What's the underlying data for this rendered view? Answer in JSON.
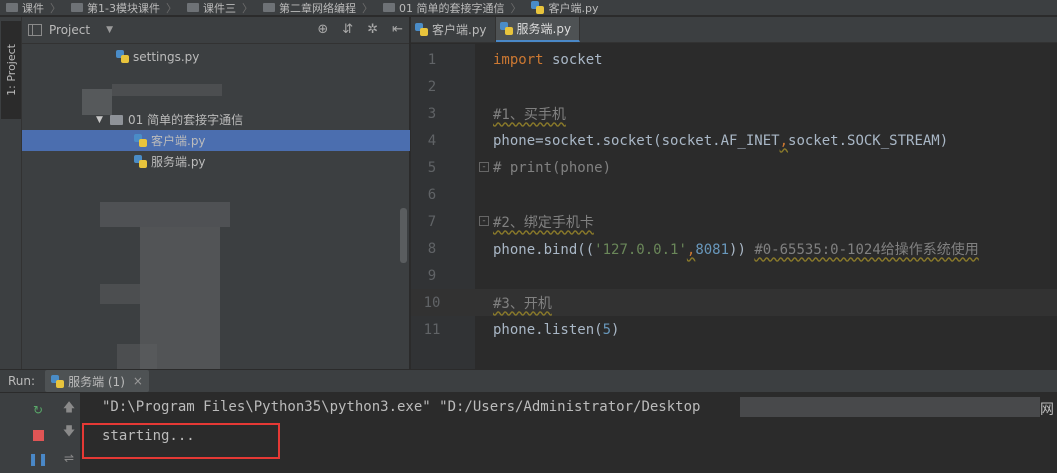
{
  "breadcrumb": [
    {
      "label": "课件",
      "icon": "folder-icon"
    },
    {
      "label": "第1-3模块课件",
      "icon": "folder-icon"
    },
    {
      "label": "课件三",
      "icon": "folder-icon"
    },
    {
      "label": "第二章网络编程",
      "icon": "folder-icon"
    },
    {
      "label": "01 简单的套接字通信",
      "icon": "folder-icon"
    },
    {
      "label": "客户端.py",
      "icon": "python-file-icon"
    }
  ],
  "tool_stripe": {
    "project_tab": "1: Project"
  },
  "project_panel": {
    "title": "Project",
    "tools": [
      "⊕",
      "⇵",
      "✲",
      "⇤"
    ],
    "tree": [
      {
        "label": "settings.py",
        "type": "file"
      },
      {
        "label": "01 简单的套接字通信",
        "type": "folder"
      },
      {
        "label": "客户端.py",
        "type": "file",
        "selected": true
      },
      {
        "label": "服务端.py",
        "type": "file"
      }
    ]
  },
  "editor": {
    "tabs": [
      {
        "label": "客户端.py",
        "active": false
      },
      {
        "label": "服务端.py",
        "active": true
      }
    ],
    "line_numbers": [
      "1",
      "2",
      "3",
      "4",
      "5",
      "6",
      "7",
      "8",
      "9",
      "10",
      "11"
    ]
  },
  "run_panel": {
    "label": "Run:",
    "tab_label": "服务端 (1)",
    "console": {
      "line1": "\"D:\\Program Files\\Python35\\python3.exe\" \"D:/Users/Administrator/Desktop",
      "line1_tail": "网",
      "line2": "starting..."
    }
  },
  "colors": {
    "background": "#2b2b2b",
    "panel": "#3c3f41",
    "selection": "#4b6eaf",
    "keyword": "#cc7832",
    "comment": "#808080",
    "string": "#6a8759",
    "number": "#6897bb",
    "highlight_box": "#e53935"
  }
}
